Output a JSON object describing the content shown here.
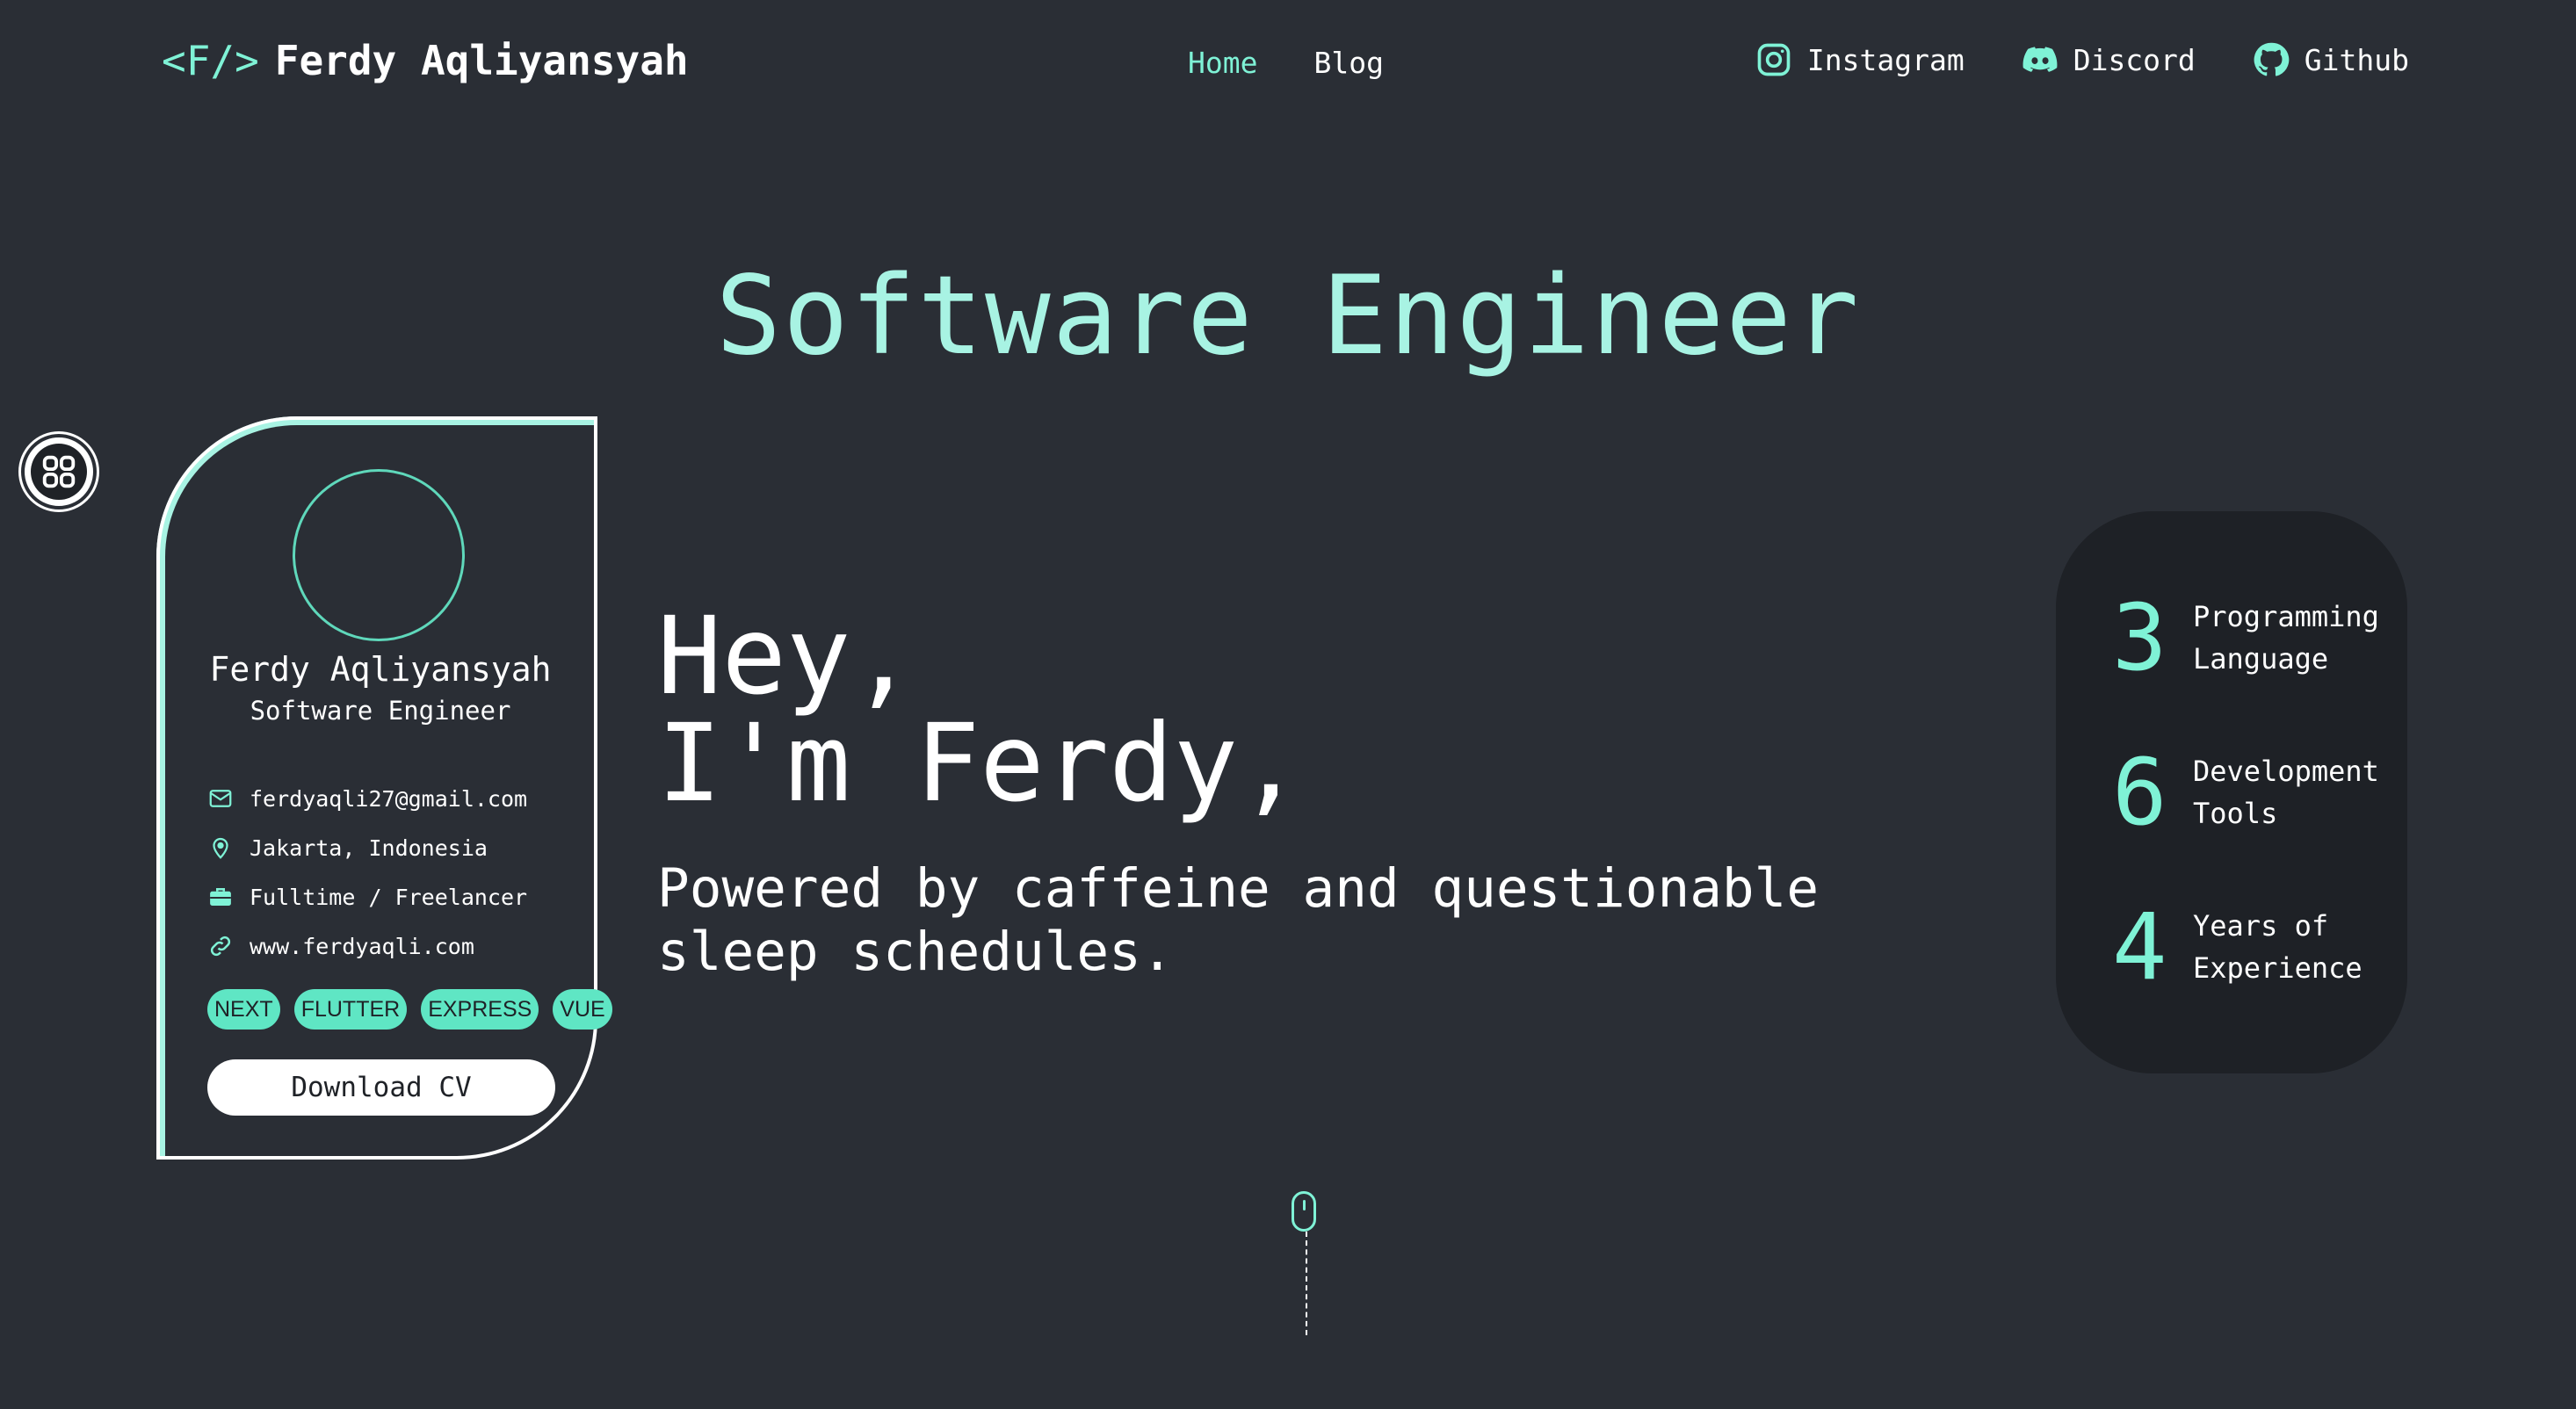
{
  "nav": {
    "brand_mark": "<F/>",
    "brand_name": "Ferdy Aqliyansyah",
    "menu": [
      {
        "label": "Home",
        "active": true
      },
      {
        "label": "Blog",
        "active": false
      }
    ],
    "social": [
      {
        "label": "Instagram",
        "icon": "instagram-icon"
      },
      {
        "label": "Discord",
        "icon": "discord-icon"
      },
      {
        "label": "Github",
        "icon": "github-icon"
      }
    ]
  },
  "hero": {
    "title": "Software Engineer",
    "greeting_line1": "Hey,",
    "greeting_line2": "I'm Ferdy,",
    "tagline": "Powered by caffeine and questionable sleep schedules."
  },
  "profile": {
    "name": "Ferdy Aqliyansyah",
    "role": "Software Engineer",
    "email": "ferdyaqli27@gmail.com",
    "location": "Jakarta, Indonesia",
    "work_type": "Fulltime / Freelancer",
    "website": "www.ferdyaqli.com",
    "tags": [
      "NEXT",
      "FLUTTER",
      "EXPRESS",
      "VUE"
    ],
    "download_label": "Download CV"
  },
  "stats": [
    {
      "value": "3",
      "label_line1": "Programming",
      "label_line2": "Language"
    },
    {
      "value": "6",
      "label_line1": "Development",
      "label_line2": "Tools"
    },
    {
      "value": "4",
      "label_line1": "Years of",
      "label_line2": "Experience"
    }
  ],
  "colors": {
    "background": "#2a2e35",
    "accent": "#7ff2d6",
    "panel": "#1e2126"
  }
}
